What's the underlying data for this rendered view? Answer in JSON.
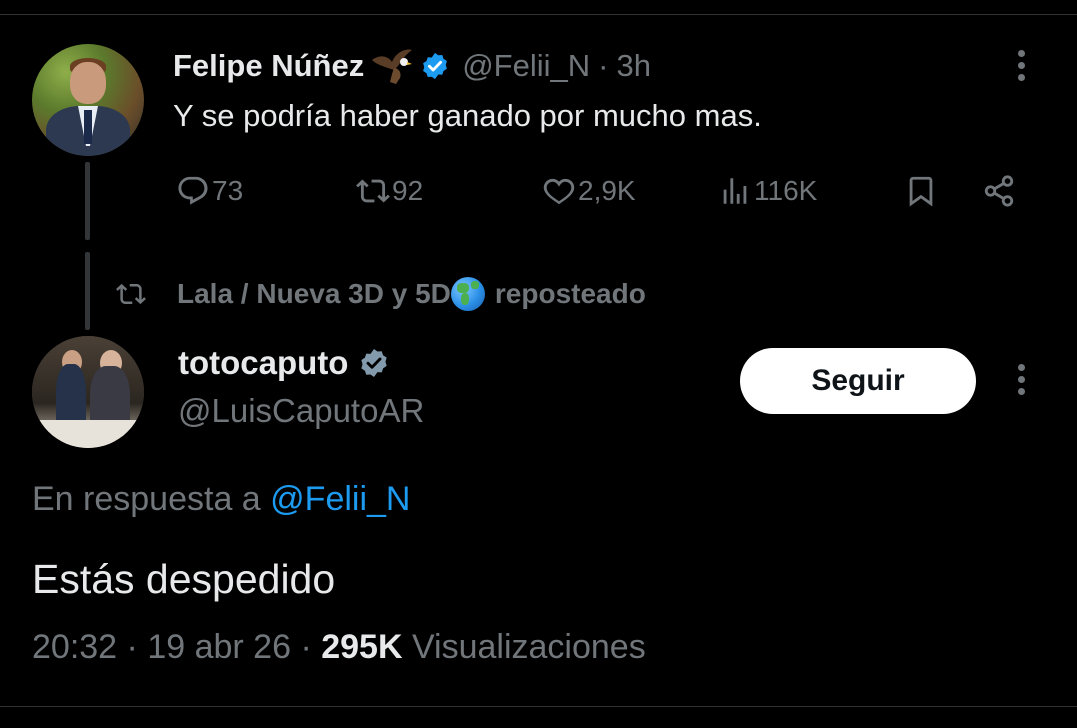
{
  "tweet1": {
    "name": "Felipe Núñez",
    "handle": "@Felii_N",
    "time_sep": "·",
    "time": "3h",
    "text": "Y se podría haber ganado por mucho mas.",
    "actions": {
      "replies": "73",
      "reposts": "92",
      "likes": "2,9K",
      "views": "116K"
    }
  },
  "repost": {
    "label_part1": "Lala / Nueva 3D y 5D",
    "label_part2": "reposteado"
  },
  "tweet2": {
    "name": "totocaputo",
    "handle": "@LuisCaputoAR",
    "follow_label": "Seguir",
    "reply_prefix": "En respuesta a",
    "reply_mention": "@Felii_N",
    "text": "Estás despedido",
    "time": "20:32",
    "date": "19 abr 26",
    "sep": "·",
    "views_count": "295K",
    "views_label": "Visualizaciones"
  },
  "colors": {
    "background": "#000000",
    "text": "#e7e9ea",
    "muted": "#71767b",
    "link": "#1d9bf0",
    "verified_blue": "#1d9bf0",
    "verified_gray": "#829aab"
  },
  "icons": [
    "reply-icon",
    "repost-icon",
    "like-icon",
    "views-icon",
    "bookmark-icon",
    "share-icon",
    "more-icon",
    "verified-badge-icon",
    "eagle-emoji-icon",
    "globe-emoji-icon"
  ]
}
